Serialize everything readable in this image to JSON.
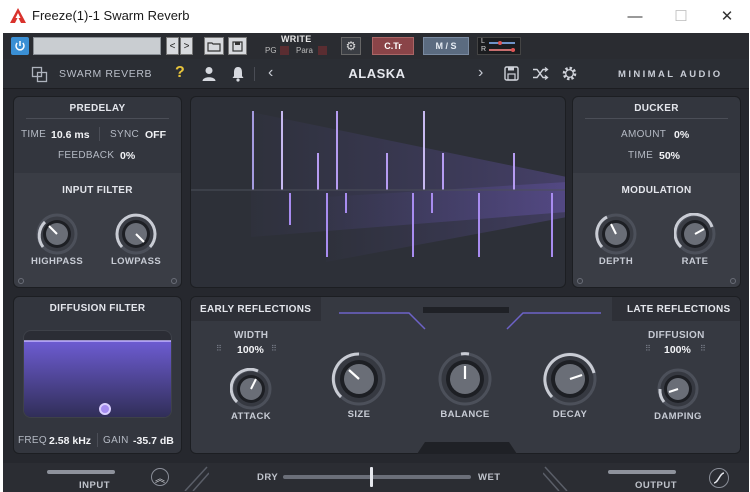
{
  "window": {
    "title": "Freeze(1)-1 Swarm Reverb",
    "min_glyph": "—",
    "max_glyph": "☐",
    "close_glyph": "✕"
  },
  "host": {
    "preset_value": "",
    "prev_arrow": "<",
    "next_arrow": ">",
    "write_label": "WRITE",
    "pg_label": "PG",
    "para_label": "Para",
    "ctr_label": "C.Tr",
    "ms_label": "M / S",
    "l_label": "L",
    "r_label": "R"
  },
  "header": {
    "plugin_name": "SWARM REVERB",
    "help_glyph": "?",
    "prev_glyph": "‹",
    "next_glyph": "›",
    "preset_name": "ALASKA",
    "brand": "MINIMAL AUDIO"
  },
  "predelay": {
    "title": "PREDELAY",
    "time_label": "TIME",
    "time_value": "10.6 ms",
    "sync_label": "SYNC",
    "sync_value": "OFF",
    "feedback_label": "FEEDBACK",
    "feedback_value": "0%"
  },
  "input_filter": {
    "title": "INPUT FILTER",
    "highpass_label": "HIGHPASS",
    "lowpass_label": "LOWPASS"
  },
  "ducker": {
    "title": "DUCKER",
    "amount_label": "AMOUNT",
    "amount_value": "0%",
    "time_label": "TIME",
    "time_value": "50%"
  },
  "modulation": {
    "title": "MODULATION",
    "depth_label": "DEPTH",
    "rate_label": "RATE"
  },
  "diffusion_filter": {
    "title": "DIFFUSION FILTER",
    "freq_label": "FREQ",
    "freq_value": "2.58 kHz",
    "gain_label": "GAIN",
    "gain_value": "-35.7 dB"
  },
  "early": {
    "title": "EARLY REFLECTIONS",
    "width_label": "WIDTH",
    "width_value": "100%",
    "attack_label": "ATTACK",
    "size_label": "SIZE",
    "balance_label": "BALANCE",
    "decay_label": "DECAY"
  },
  "late": {
    "title": "LATE REFLECTIONS",
    "diffusion_label": "DIFFUSION",
    "diffusion_value": "100%",
    "damping_label": "DAMPING"
  },
  "footer": {
    "input_label": "INPUT",
    "dry_label": "DRY",
    "wet_label": "WET",
    "output_label": "OUTPUT",
    "dry_wet_mix": 0.47
  },
  "colors": {
    "accent": "#7d63d6",
    "panel": "#33363e",
    "background": "#26282e"
  }
}
